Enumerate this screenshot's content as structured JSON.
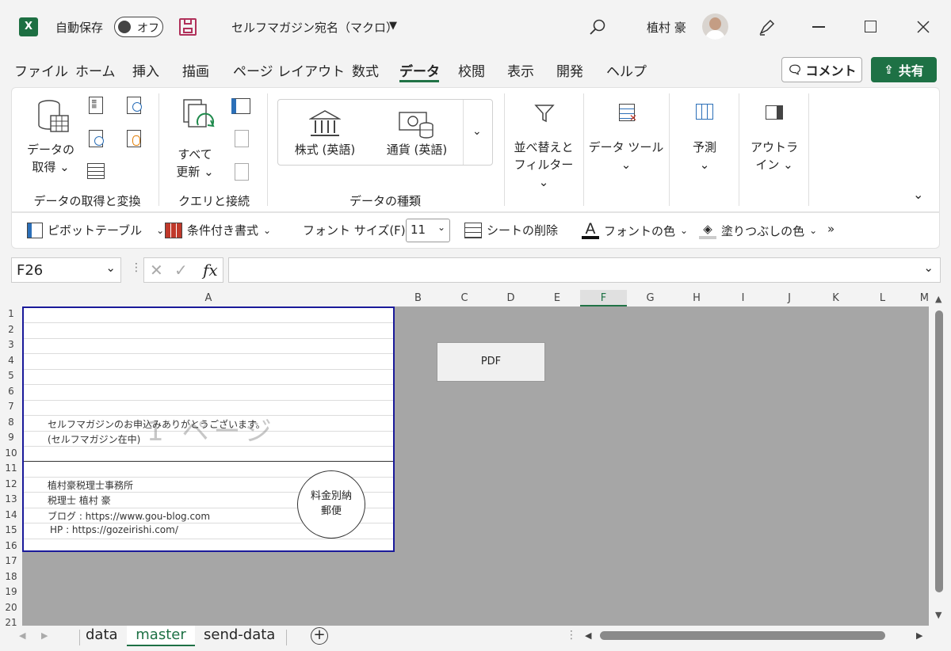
{
  "titlebar": {
    "autosave_label": "自動保存",
    "toggle_label": "オフ",
    "doc_title": "セルフマガジン宛名（マクロ）",
    "user_name": "植村 豪"
  },
  "menu": [
    "ファイル",
    "ホーム",
    "挿入",
    "描画",
    "ページ レイアウト",
    "数式",
    "データ",
    "校閲",
    "表示",
    "開発",
    "ヘルプ"
  ],
  "menu_active": "データ",
  "actions": {
    "comment": "コメント",
    "share": "共有"
  },
  "ribbon": {
    "get_data": "データの取得",
    "get_data_l1": "データの",
    "get_data_l2": "取得 ⌄",
    "refresh_l1": "すべて",
    "refresh_l2": "更新 ⌄",
    "stocks": "株式 (英語)",
    "currency": "通貨 (英語)",
    "sort_l1": "並べ替えと",
    "sort_l2": "フィルター ⌄",
    "datatools": "データ ツール",
    "forecast": "予測",
    "outline_l1": "アウトラ",
    "outline_l2": "イン ⌄",
    "group_get": "データの取得と変換",
    "group_query": "クエリと接続",
    "group_types": "データの種類"
  },
  "quickbar": {
    "pivot": "ピボットテーブル",
    "conditional": "条件付き書式",
    "fontsize_label": "フォント サイズ(F):",
    "fontsize_value": "11",
    "delete_sheet": "シートの削除",
    "font_color": "フォントの色",
    "fill_color": "塗りつぶしの色",
    "more": "»"
  },
  "namebox": "F26",
  "fx": "fx",
  "columns": [
    "A",
    "B",
    "C",
    "D",
    "E",
    "F",
    "G",
    "H",
    "I",
    "J",
    "K",
    "L",
    "M"
  ],
  "selected_column": "F",
  "rows": [
    "1",
    "2",
    "3",
    "4",
    "5",
    "6",
    "7",
    "8",
    "9",
    "10",
    "11",
    "12",
    "13",
    "14",
    "15",
    "16",
    "17",
    "18",
    "19",
    "20",
    "21"
  ],
  "cells": {
    "a8": "セルフマガジンのお申込みありがとうございます。",
    "a9": "(セルフマガジン在中)",
    "a12": "植村豪税理士事務所",
    "a13": "税理士 植村 豪",
    "a14": "ブログ : https://www.gou-blog.com",
    "a15": "HP : https://gozeirishi.com/"
  },
  "stamp": {
    "line1": "料金別納",
    "line2": "郵便"
  },
  "watermark": "1 ページ",
  "pdf_button": "PDF",
  "sheets": [
    "data",
    "master",
    "send-data"
  ],
  "active_sheet": "master",
  "colors": {
    "accent": "#217346",
    "share": "#1e7145",
    "page_border": "#1a1a9a"
  }
}
